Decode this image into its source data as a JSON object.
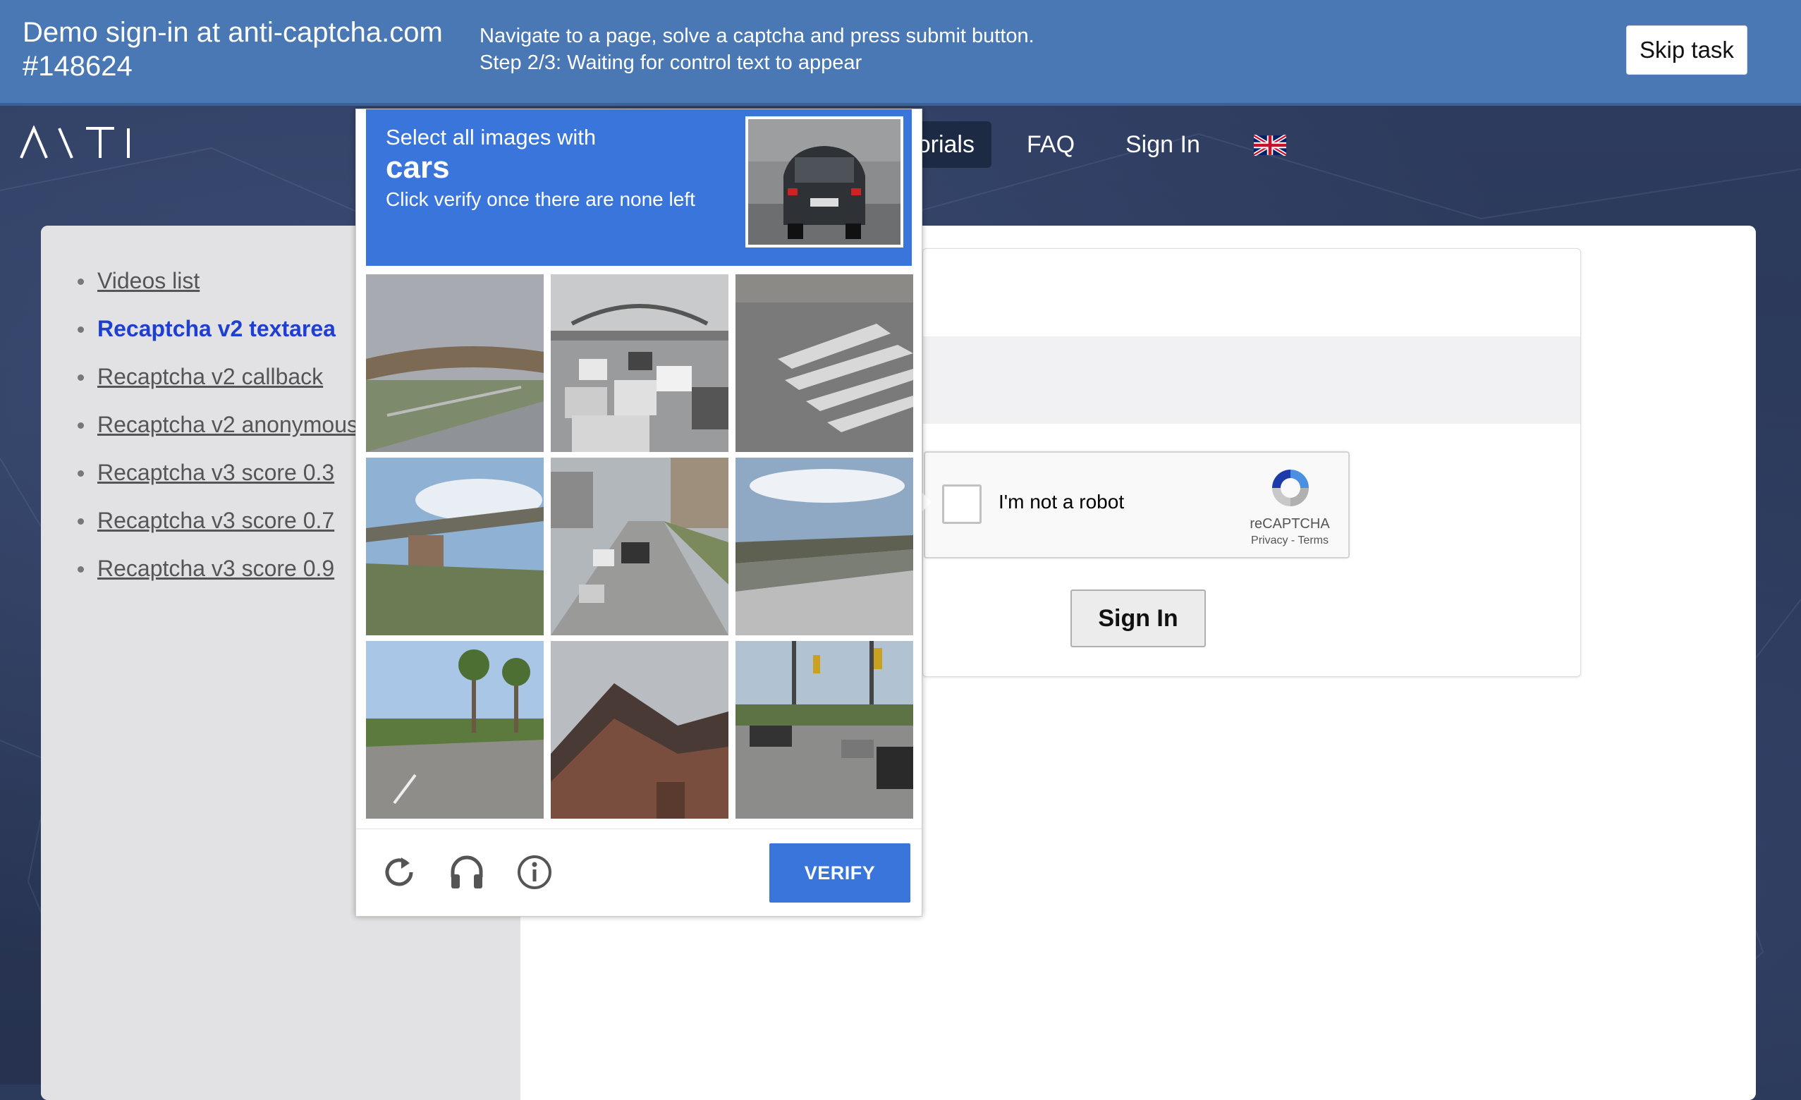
{
  "task": {
    "title": "Demo sign-in at anti-captcha.com #148624",
    "instruction_1": "Navigate to a page, solve a captcha and press submit button.",
    "instruction_2": "Step 2/3: Waiting for control text to appear",
    "skip_label": "Skip task"
  },
  "nav": {
    "logo_text": "ANTI",
    "tutorials_label": "Tutorials",
    "faq_label": "FAQ",
    "signin_label": "Sign In",
    "language_icon": "uk-flag-icon"
  },
  "sidebar": {
    "items": [
      {
        "label": "Videos list"
      },
      {
        "label": "Recaptcha v2 textarea"
      },
      {
        "label": "Recaptcha v2 callback"
      },
      {
        "label": "Recaptcha v2 anonymous"
      },
      {
        "label": "Recaptcha v3 score 0.3"
      },
      {
        "label": "Recaptcha v3 score 0.7"
      },
      {
        "label": "Recaptcha v3 score 0.9"
      }
    ]
  },
  "recaptcha_widget": {
    "label": "I'm not a robot",
    "brand": "reCAPTCHA",
    "links": "Privacy - Terms"
  },
  "form": {
    "signin_button": "Sign In"
  },
  "challenge": {
    "line1": "Select all images with",
    "target": "cars",
    "line3": "Click verify once there are none left",
    "verify_label": "VERIFY",
    "tiles": [
      "overpass",
      "highway-traffic",
      "crosswalk",
      "bridge",
      "road-with-cars",
      "freeway",
      "palm-street",
      "house-roof",
      "intersection"
    ]
  },
  "colors": {
    "banner": "#4a78b4",
    "captcha_blue": "#3a75dc",
    "active_link": "#1e3fcf"
  }
}
